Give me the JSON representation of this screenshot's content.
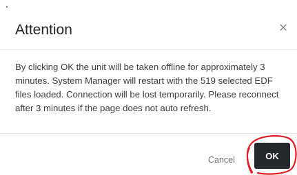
{
  "dialog": {
    "title": "Attention",
    "close_glyph": "close-icon",
    "message": "By clicking OK the unit will be taken offline for approximately 3 minutes. System Manager will restart with the 519 selected EDF files loaded. Connection will be lost temporarily. Please reconnect after 3 minutes if the page does not auto refresh.",
    "buttons": {
      "cancel_label": "Cancel",
      "ok_label": "OK"
    }
  },
  "colors": {
    "ok_background": "#24272c",
    "annotation_circle": "#e01b24",
    "divider": "#e2e4e7"
  }
}
